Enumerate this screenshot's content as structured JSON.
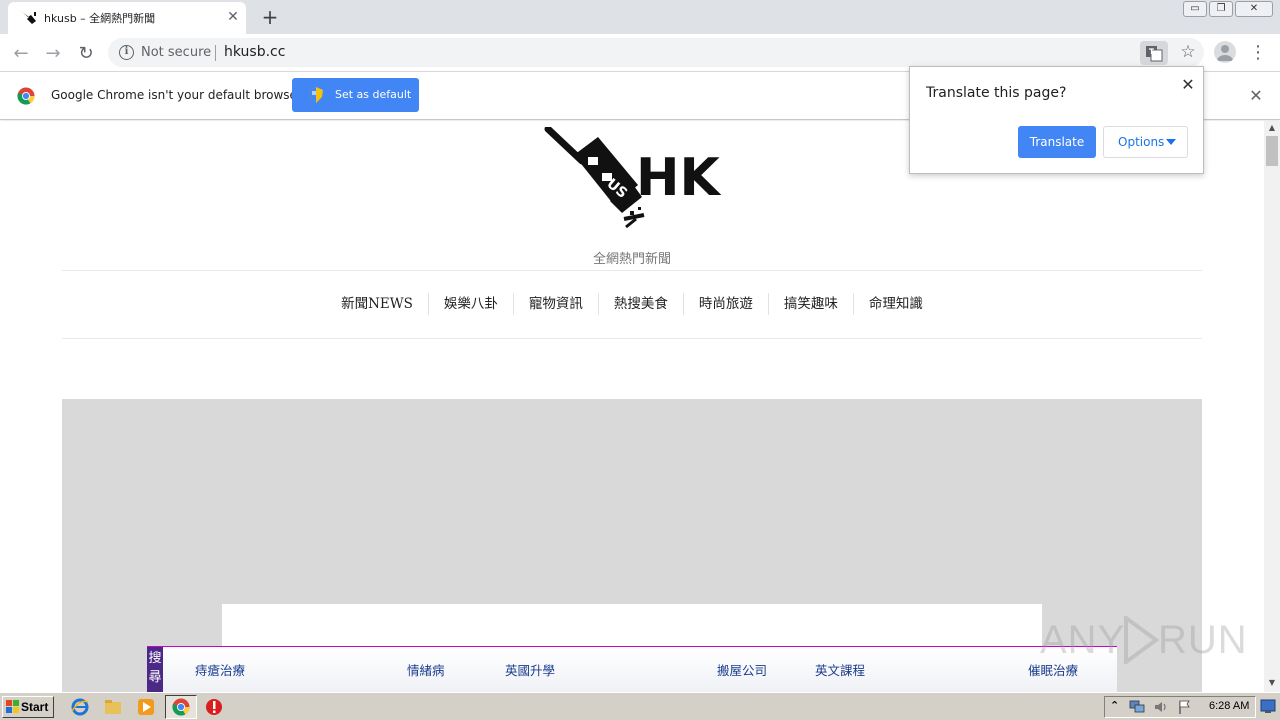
{
  "tab": {
    "title": "hkusb – 全網熱門新聞",
    "close_glyph": "✕",
    "new_tab_glyph": "+"
  },
  "window_controls": {
    "minimize": "▭",
    "restore": "❐",
    "close": "✕"
  },
  "toolbar": {
    "back_glyph": "←",
    "forward_glyph": "→",
    "reload_glyph": "↻",
    "security_glyph": "i",
    "security_label": "Not secure",
    "url": "hkusb.cc",
    "bookmark_glyph": "☆",
    "menu_glyph": "⋮"
  },
  "infobar": {
    "message": "Google Chrome isn't your default browser",
    "button_label": "Set as default",
    "close_glyph": "✕"
  },
  "translate_popup": {
    "title": "Translate this page?",
    "close_glyph": "✕",
    "translate_label": "Translate",
    "options_label": "Options"
  },
  "site": {
    "logo_text": "HK",
    "tagline": "全網熱門新聞",
    "nav": [
      "新聞NEWS",
      "娛樂八卦",
      "寵物資訊",
      "熱搜美食",
      "時尚旅遊",
      "搞笑趣味",
      "命理知識"
    ]
  },
  "search_bar": {
    "tag": [
      "搜",
      "尋"
    ],
    "links": [
      "痔瘡治療",
      "情緒病",
      "英國升學",
      "搬屋公司",
      "英文課程",
      "催眠治療"
    ]
  },
  "scrollbar": {
    "up_glyph": "▲",
    "down_glyph": "▼"
  },
  "watermark": {
    "text_a": "ANY",
    "text_b": "RUN"
  },
  "taskbar": {
    "start_label": "Start",
    "tray_chevron": "⌃",
    "clock": "6:28 AM"
  },
  "colors": {
    "chrome_blue": "#4285f4",
    "tab_strip": "#dee1e6",
    "ad_gray": "#d9d9d9",
    "search_tag_purple": "#4b2a87",
    "taskbar": "#d4d0c8"
  },
  "icons": {
    "tab_favicon": "usb-plug-icon",
    "omnibox_translate": "translate-icon",
    "profile": "avatar-icon",
    "infobar": "chrome-logo-icon",
    "set_default": "shield-icon",
    "taskbar": [
      "ie-icon",
      "explorer-folder-icon",
      "media-player-icon",
      "chrome-icon",
      "stop-icon"
    ],
    "tray": [
      "network-icon",
      "volume-icon",
      "flag-icon"
    ]
  }
}
